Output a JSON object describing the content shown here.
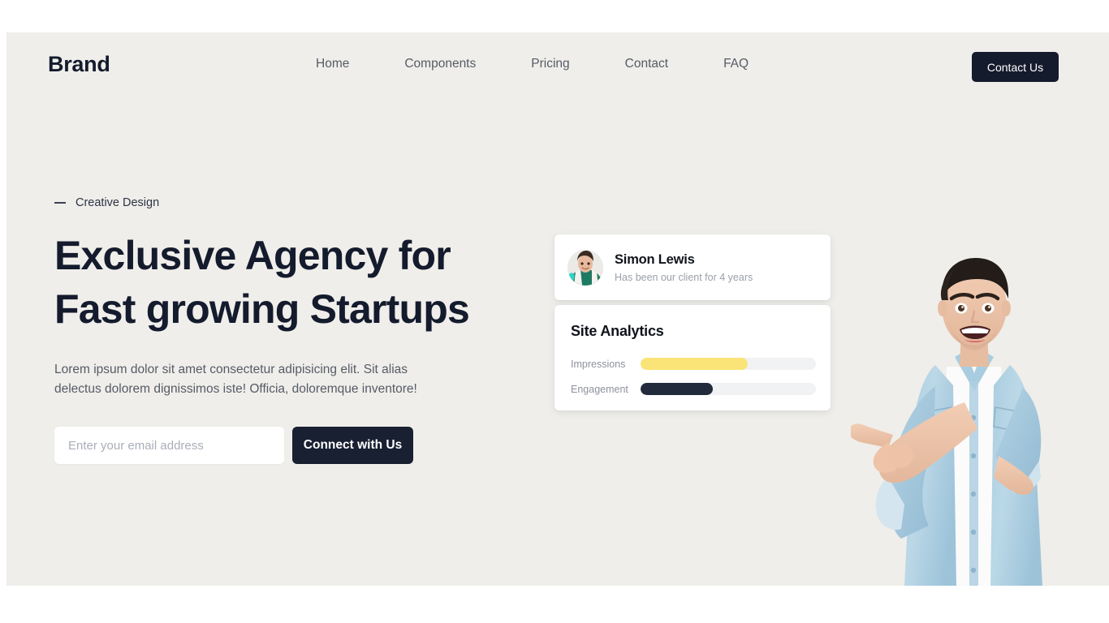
{
  "theme": {
    "page_bg": "#efeeea",
    "outer_bg": "#ffffff",
    "ink": "#141b2d",
    "muted": "#565b66",
    "accent_yellow": "#fae477",
    "accent_dark": "#222b3c"
  },
  "navbar": {
    "brand": "Brand",
    "links": [
      {
        "label": "Home"
      },
      {
        "label": "Components"
      },
      {
        "label": "Pricing"
      },
      {
        "label": "Contact"
      },
      {
        "label": "FAQ"
      }
    ],
    "cta_label": "Contact Us"
  },
  "hero": {
    "eyebrow": "Creative Design",
    "eyebrow_icon": "em-dash-icon",
    "title": "Exclusive Agency for\nFast growing Startups",
    "subtitle": "Lorem ipsum dolor sit amet consectetur adipisicing elit. Sit alias\ndelectus dolorem dignissimos iste! Officia, doloremque inventore!",
    "form": {
      "email_placeholder": "Enter your email address",
      "email_value": "",
      "submit_label": "Connect with Us"
    }
  },
  "testimonial": {
    "avatar_icon": "user-avatar-photo",
    "name": "Simon Lewis",
    "role": "Has been our client for 4 years"
  },
  "analytics": {
    "title": "Site Analytics",
    "metrics": [
      {
        "label": "Impressions",
        "percent": 61,
        "color": "#fae477"
      },
      {
        "label": "Engagement",
        "percent": 41,
        "color": "#222b3c"
      }
    ]
  },
  "hero_image": {
    "icon": "person-pointing-left-photo",
    "alt": "Smiling man in light blue denim shirt pointing to the left"
  }
}
